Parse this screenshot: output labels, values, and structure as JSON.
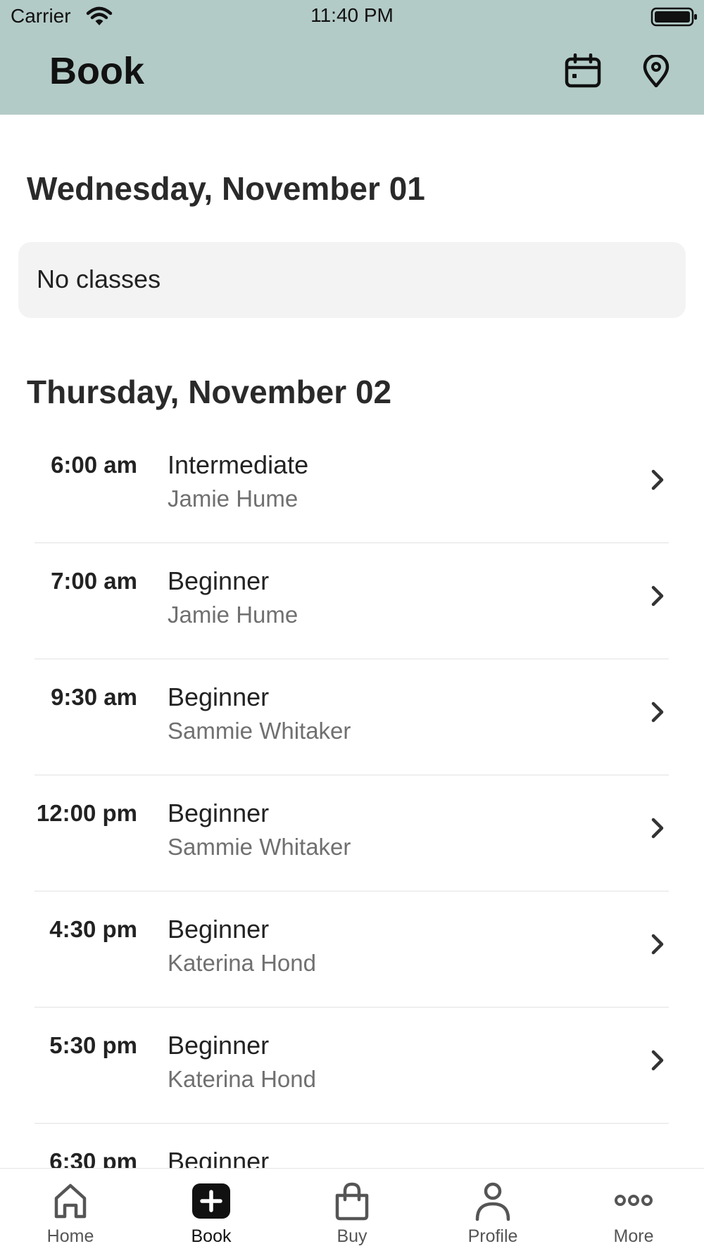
{
  "status_bar": {
    "carrier": "Carrier",
    "time": "11:40 PM"
  },
  "header": {
    "title": "Book",
    "calendar_icon": "calendar-icon",
    "location_icon": "location-pin-icon"
  },
  "days": [
    {
      "heading": "Wednesday, November 01",
      "empty_text": "No classes"
    },
    {
      "heading": "Thursday, November 02",
      "classes": [
        {
          "time": "6:00 am",
          "name": "Intermediate",
          "instructor": "Jamie Hume"
        },
        {
          "time": "7:00 am",
          "name": "Beginner",
          "instructor": "Jamie Hume"
        },
        {
          "time": "9:30 am",
          "name": "Beginner",
          "instructor": "Sammie Whitaker"
        },
        {
          "time": "12:00 pm",
          "name": "Beginner",
          "instructor": "Sammie Whitaker"
        },
        {
          "time": "4:30 pm",
          "name": "Beginner",
          "instructor": "Katerina Hond"
        },
        {
          "time": "5:30 pm",
          "name": "Beginner",
          "instructor": "Katerina Hond"
        },
        {
          "time": "6:30 pm",
          "name": "Beginner",
          "instructor": ""
        }
      ]
    }
  ],
  "tabbar": {
    "items": [
      {
        "label": "Home",
        "icon": "home-icon"
      },
      {
        "label": "Book",
        "icon": "plus-square-icon",
        "active": true
      },
      {
        "label": "Buy",
        "icon": "shopping-bag-icon"
      },
      {
        "label": "Profile",
        "icon": "person-icon"
      },
      {
        "label": "More",
        "icon": "more-dots-icon"
      }
    ]
  },
  "colors": {
    "header_bg": "#b3cbc7",
    "empty_box_bg": "#f3f3f3",
    "divider": "#e2e2e2"
  }
}
